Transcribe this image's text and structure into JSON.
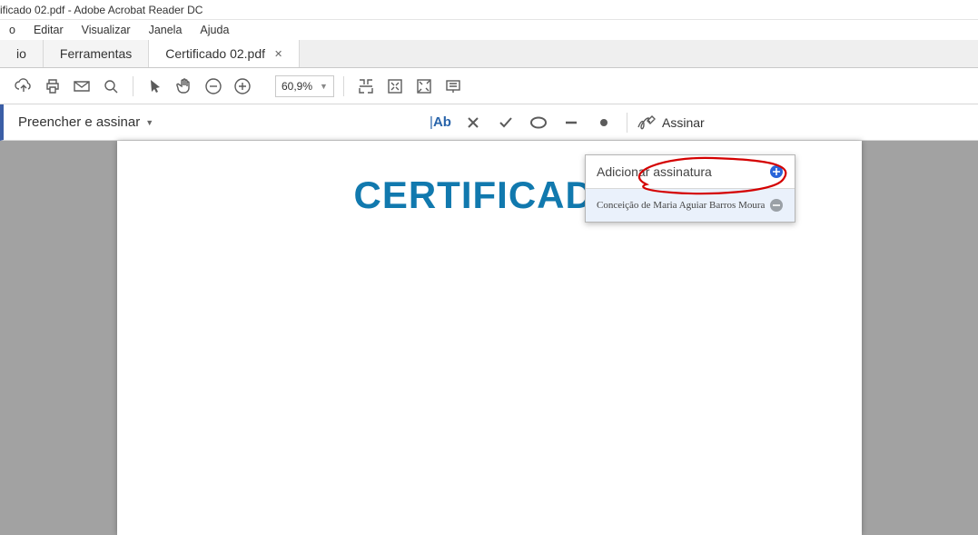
{
  "title": "ificado 02.pdf - Adobe Acrobat Reader DC",
  "menu": {
    "arquivo": "o",
    "editar": "Editar",
    "visualizar": "Visualizar",
    "janela": "Janela",
    "ajuda": "Ajuda"
  },
  "tabs": {
    "inicio": "io",
    "ferramentas": "Ferramentas",
    "doc": "Certificado 02.pdf"
  },
  "toolbar": {
    "zoom": "60,9%"
  },
  "fillbar": {
    "title": "Preencher e assinar",
    "text_tool": "Ab",
    "sign_label": "Assinar"
  },
  "popup": {
    "add_sig": "Adicionar assinatura",
    "existing_sig": "Conceição de Maria Aguiar Barros Moura"
  },
  "page": {
    "heading": "CERTIFICADO"
  }
}
